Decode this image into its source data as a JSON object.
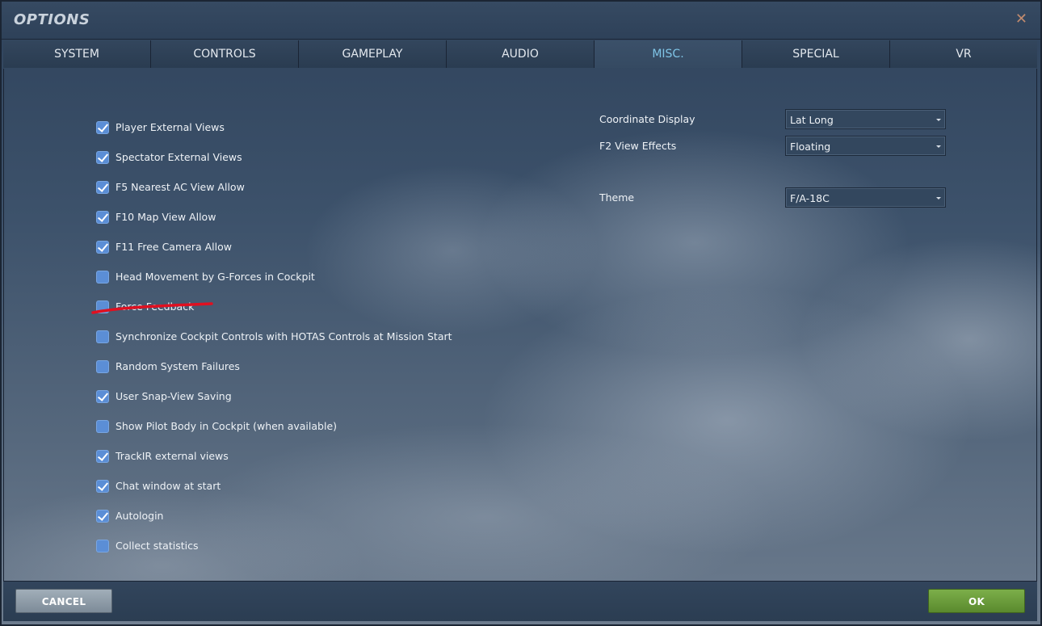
{
  "window": {
    "title": "OPTIONS",
    "close_glyph": "✕"
  },
  "tabs": [
    {
      "label": "SYSTEM",
      "active": false
    },
    {
      "label": "CONTROLS",
      "active": false
    },
    {
      "label": "GAMEPLAY",
      "active": false
    },
    {
      "label": "AUDIO",
      "active": false
    },
    {
      "label": "MISC.",
      "active": true
    },
    {
      "label": "SPECIAL",
      "active": false
    },
    {
      "label": "VR",
      "active": false
    }
  ],
  "checkboxes": [
    {
      "label": "Player External Views",
      "checked": true
    },
    {
      "label": "Spectator External Views",
      "checked": true
    },
    {
      "label": "F5 Nearest AC View Allow",
      "checked": true
    },
    {
      "label": "F10 Map View Allow",
      "checked": true
    },
    {
      "label": "F11 Free Camera Allow",
      "checked": true
    },
    {
      "label": "Head Movement by G-Forces in Cockpit",
      "checked": false
    },
    {
      "label": "Force Feedback",
      "checked": false
    },
    {
      "label": "Synchronize Cockpit Controls with HOTAS Controls at Mission Start",
      "checked": false
    },
    {
      "label": "Random System Failures",
      "checked": false
    },
    {
      "label": "User Snap-View Saving",
      "checked": true
    },
    {
      "label": "Show Pilot Body in Cockpit (when available)",
      "checked": false
    },
    {
      "label": "TrackIR external views",
      "checked": true
    },
    {
      "label": "Chat window at start",
      "checked": true
    },
    {
      "label": "Autologin",
      "checked": true
    },
    {
      "label": "Collect statistics",
      "checked": false
    }
  ],
  "settings": [
    {
      "label": "Coordinate Display",
      "value": "Lat Long"
    },
    {
      "label": "F2 View Effects",
      "value": "Floating"
    },
    {
      "label": "Theme",
      "value": "F/A-18C"
    }
  ],
  "footer": {
    "cancel_label": "CANCEL",
    "ok_label": "OK"
  },
  "colors": {
    "active_tab_text": "#7fc4e6",
    "checkbox_fill": "#5b8ed6",
    "annotation_red": "#e01020",
    "ok_button": "#6a9c3b",
    "cancel_button": "#8e9ba7"
  }
}
